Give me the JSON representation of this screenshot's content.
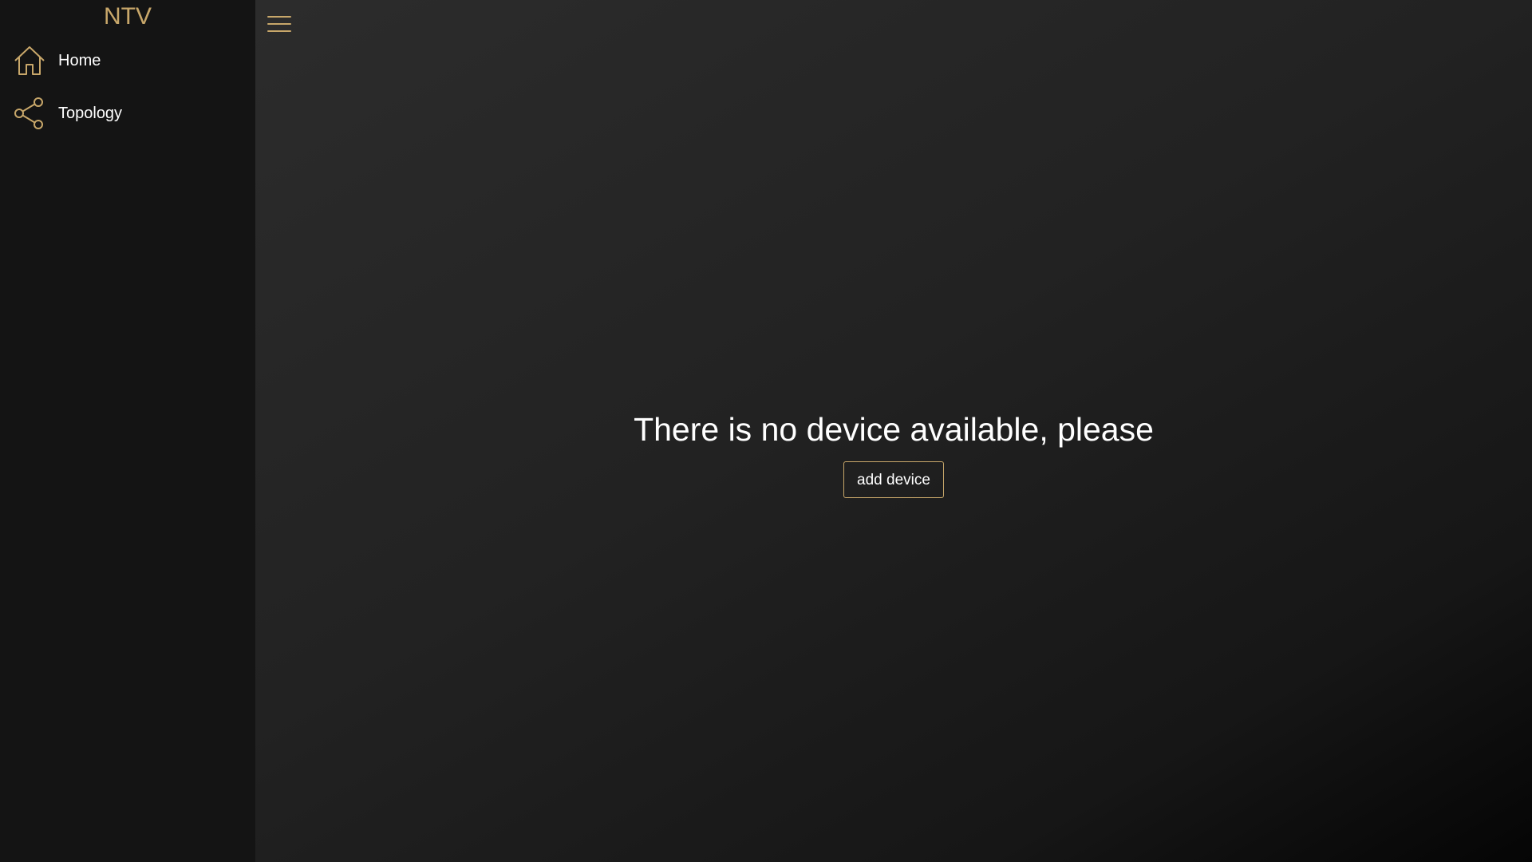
{
  "app": {
    "brand": "NTV",
    "accent_color": "#c8a76a"
  },
  "sidebar": {
    "items": [
      {
        "label": "Home",
        "icon": "home-icon"
      },
      {
        "label": "Topology",
        "icon": "share-icon"
      }
    ]
  },
  "header": {
    "menu_icon": "hamburger-menu-icon"
  },
  "main": {
    "empty_message": "There is no device available, please",
    "add_device_label": "add device"
  }
}
